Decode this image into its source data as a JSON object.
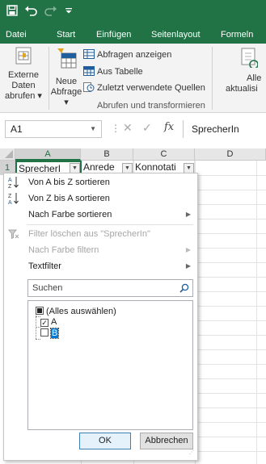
{
  "quick_access": {
    "save_icon": "save-icon",
    "undo_icon": "undo-icon",
    "redo_icon": "redo-icon",
    "customize_icon": "customize-icon"
  },
  "tabs": [
    "Datei",
    "Start",
    "Einfügen",
    "Seitenlayout",
    "Formeln"
  ],
  "ribbon": {
    "get_external": "Externe Daten abrufen",
    "get_external_line1": "Externe Daten",
    "get_external_line2": "abrufen",
    "new_query_line1": "Neue",
    "new_query_line2": "Abfrage",
    "show_queries": "Abfragen anzeigen",
    "from_table": "Aus Tabelle",
    "recent_sources": "Zuletzt verwendete Quellen",
    "group_label": "Abrufen und transformieren",
    "refresh_line1": "Alle",
    "refresh_line2": "aktualisi"
  },
  "formula_bar": {
    "name_box": "A1",
    "fx": "fx",
    "content": "SprecherIn"
  },
  "grid": {
    "columns": [
      "A",
      "B",
      "C",
      "D"
    ],
    "rows": [
      "1"
    ],
    "row1": [
      "SprecherI",
      "Anrede",
      "Konnotati"
    ]
  },
  "filter_menu": {
    "sort_az": "Von A bis Z sortieren",
    "sort_za": "Von Z bis A sortieren",
    "sort_color": "Nach Farbe sortieren",
    "clear_filter": "Filter löschen aus \"SprecherIn\"",
    "filter_color": "Nach Farbe filtern",
    "text_filter": "Textfilter",
    "search_placeholder": "Suchen",
    "items": [
      {
        "label": "(Alles auswählen)",
        "state": "indeterminate"
      },
      {
        "label": "A",
        "state": "checked"
      },
      {
        "label": "B",
        "state": "unchecked"
      }
    ],
    "ok": "OK",
    "cancel": "Abbrechen"
  },
  "colors": {
    "excel_green": "#217346",
    "ribbon_bg": "#f3f3f3",
    "selection": "#0078d7"
  }
}
